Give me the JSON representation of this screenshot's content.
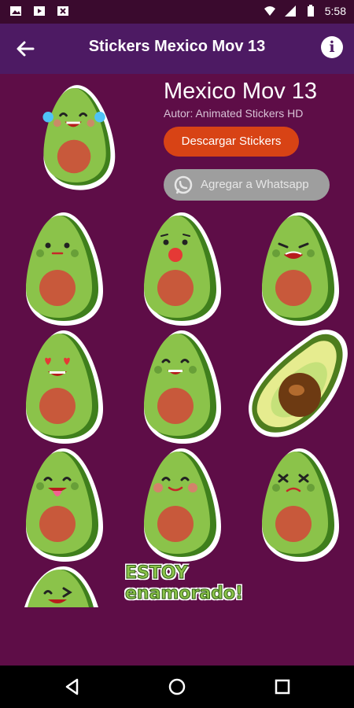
{
  "status_bar": {
    "time": "5:58",
    "left_icons": [
      "photo-icon",
      "play-icon",
      "close-square-icon"
    ],
    "right_icons": [
      "wifi-icon",
      "signal-icon",
      "battery-icon"
    ]
  },
  "app_bar": {
    "title": "Stickers Mexico Mov 13",
    "back_icon": "arrow-left-icon",
    "info_icon": "info-icon"
  },
  "pack": {
    "title": "Mexico Mov 13",
    "author": "Autor: Animated Stickers HD",
    "download_label": "Descargar Stickers",
    "whatsapp_label": "Agregar a Whatsapp"
  },
  "stickers": {
    "tray_icon": "avocado-crying-laughing",
    "items": [
      "avocado-neutral",
      "avocado-red-nose",
      "avocado-grimace",
      "avocado-heart-eyes",
      "avocado-smile",
      "avocado-half-pit",
      "avocado-tongue",
      "avocado-blush",
      "avocado-dizzy",
      "avocado-wink",
      "text-estoy-enamorado"
    ],
    "text_sticker": {
      "line1": "ESTOY",
      "line2": "enamorado!"
    }
  },
  "nav_bar": {
    "icons": [
      "back-triangle-icon",
      "home-circle-icon",
      "recents-square-icon"
    ]
  },
  "colors": {
    "background": "#5e0d47",
    "app_bar": "#4d1a63",
    "status_bar": "#3a0a2e",
    "download_button": "#d84315",
    "whatsapp_button": "#9e9e9e",
    "avocado_skin": "#8bc34a",
    "avocado_pit": "#c8593b"
  }
}
